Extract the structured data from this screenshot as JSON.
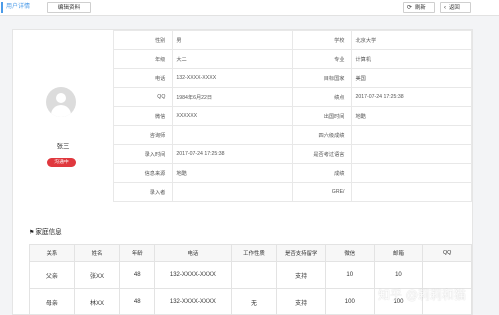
{
  "topbar": {
    "tab_active": "用户详情",
    "edit_button": "编辑资料",
    "refresh_button": "刷新",
    "back_button": "返回"
  },
  "profile": {
    "name": "张三",
    "status": "沟通中"
  },
  "info": [
    {
      "k1": "性别",
      "v1": "男",
      "k2": "学校",
      "v2": "北京大学"
    },
    {
      "k1": "年级",
      "v1": "大二",
      "k2": "专业",
      "v2": "计算机"
    },
    {
      "k1": "电话",
      "v1": "132-XXXX-XXXX",
      "k2": "目标国家",
      "v2": "美国"
    },
    {
      "k1": "QQ",
      "v1": "1984年6月22日",
      "k2": "绩点",
      "v2": "2017-07-24 17:25:38"
    },
    {
      "k1": "微信",
      "v1": "XXXXXX",
      "k2": "出国时间",
      "v2": "地酷"
    },
    {
      "k1": "咨询师",
      "v1": "",
      "k2": "四六级成绩",
      "v2": ""
    },
    {
      "k1": "录入时间",
      "v1": "2017-07-24 17:25:38",
      "k2": "是否考过语言",
      "v2": ""
    },
    {
      "k1": "信息来源",
      "v1": "地酷",
      "k2": "成绩",
      "v2": ""
    },
    {
      "k1": "录入者",
      "v1": "",
      "k2": "GRE/",
      "v2": ""
    }
  ],
  "family": {
    "title": "家庭信息",
    "headers": [
      "关系",
      "姓名",
      "年龄",
      "电话",
      "工作性质",
      "是否支持留学",
      "微信",
      "邮箱",
      "QQ"
    ],
    "rows": [
      [
        "父亲",
        "张XX",
        "48",
        "132-XXXX-XXXX",
        "",
        "支持",
        "10",
        "10",
        ""
      ],
      [
        "母亲",
        "林XX",
        "48",
        "132-XXXX-XXXX",
        "无",
        "支持",
        "100",
        "100",
        ""
      ]
    ]
  },
  "watermark": "知乎 @莉莉和猫"
}
